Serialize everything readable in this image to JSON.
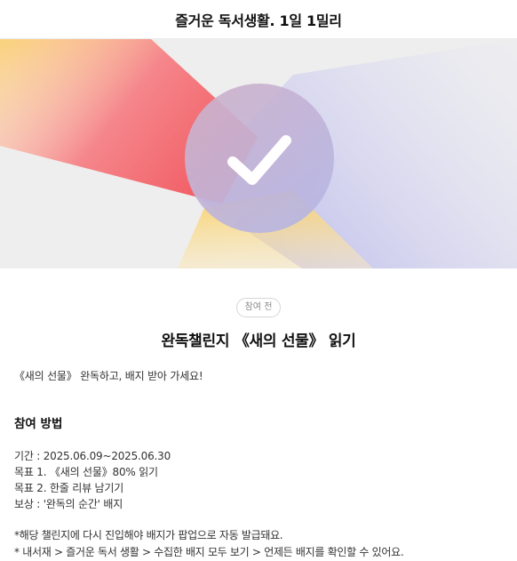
{
  "header": {
    "title": "즐거운 독서생활. 1일 1밀리"
  },
  "hero": {
    "icon": "checkmark-icon",
    "colors": {
      "background": "#eeeeee",
      "red": "#f5747a",
      "blue": "#c9c8ef",
      "yellow": "#fbd97a",
      "circle": "#c4b6dd",
      "check": "#ffffff"
    }
  },
  "status_badge": "참여 전",
  "title": "완독챌린지 《새의 선물》 읽기",
  "intro": "《새의 선물》 완독하고, 배지 받아 가세요!",
  "section_title": "참여 방법",
  "info_lines": [
    "기간 : 2025.06.09~2025.06.30",
    "목표 1. 《새의 선물》80% 읽기",
    "목표 2. 한줄 리뷰 남기기",
    "보상 : '완독의 순간' 배지"
  ],
  "notes": [
    "*해당 챌린지에 다시 진입해야 배지가 팝업으로 자동 발급돼요.",
    "* 내서재 > 즐거운 독서 생활 > 수집한 배지 모두 보기 > 언제든 배지를 확인할 수 있어요."
  ]
}
